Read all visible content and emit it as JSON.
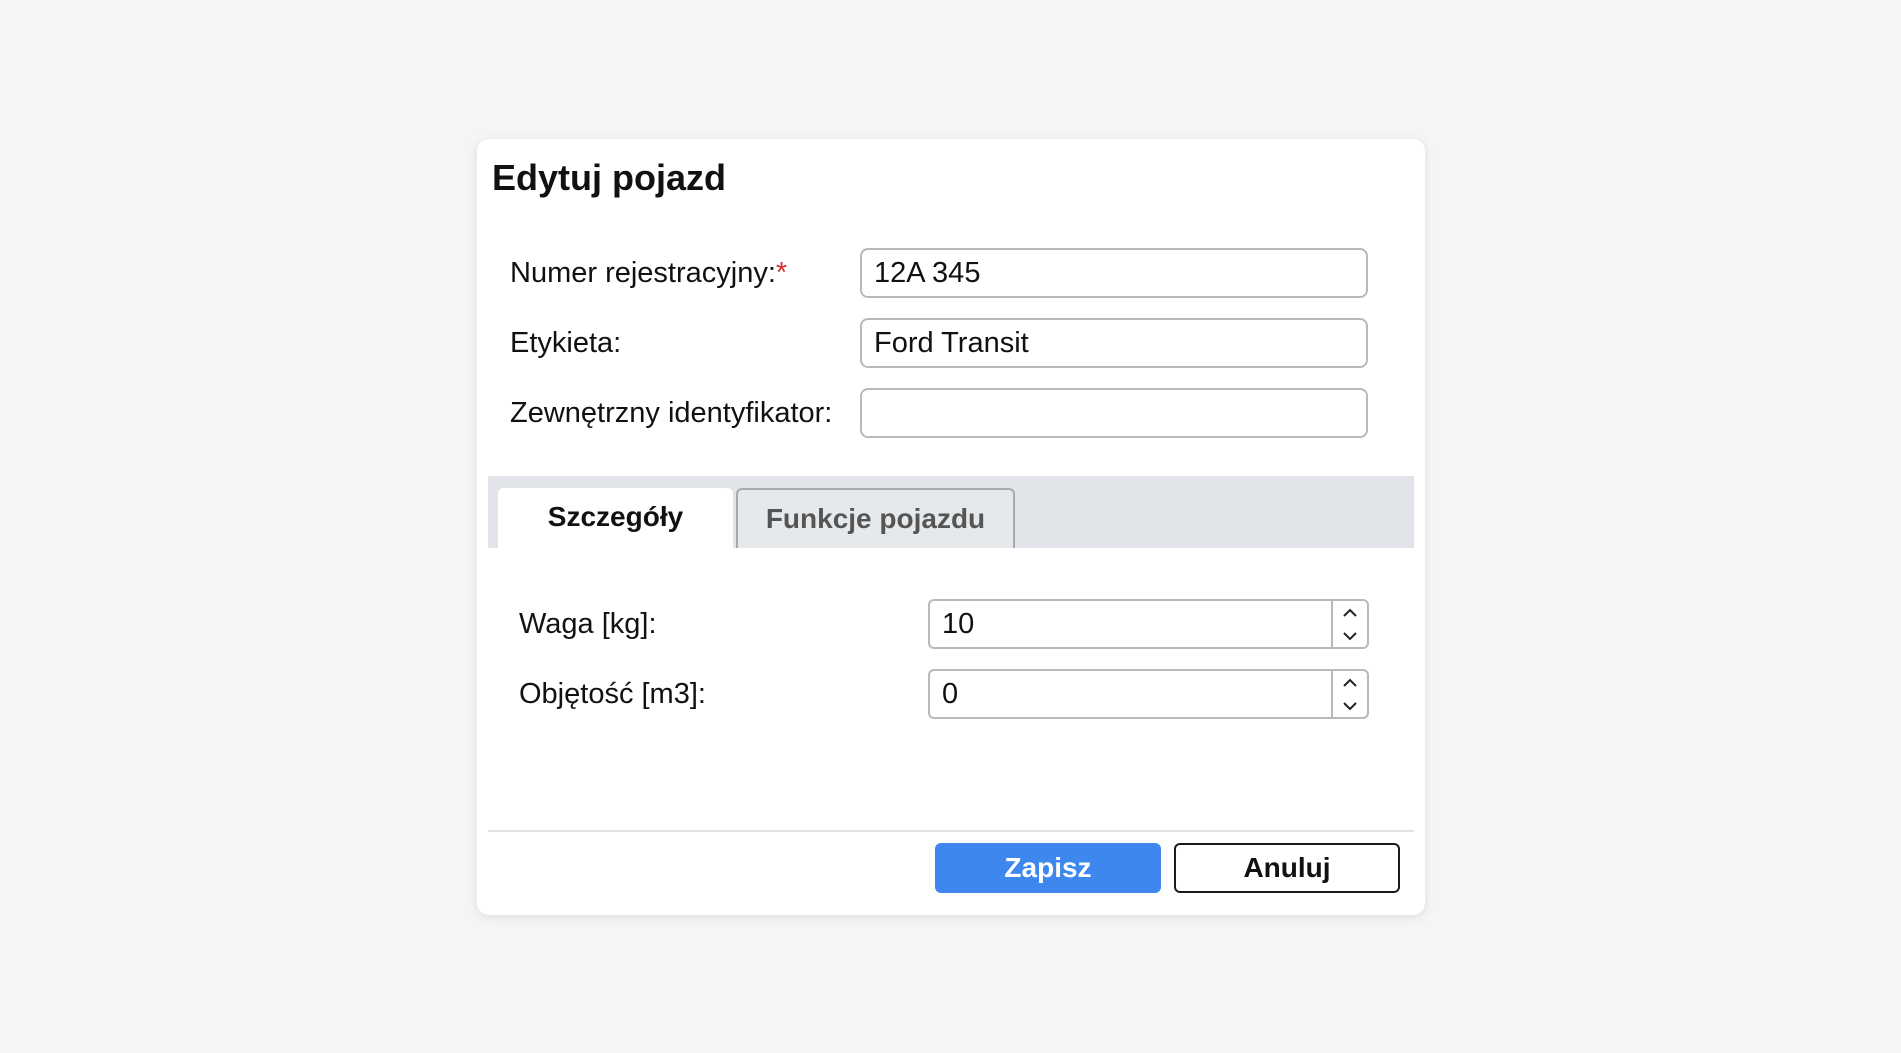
{
  "dialog": {
    "title": "Edytuj pojazd"
  },
  "form": {
    "registration": {
      "label": "Numer rejestracyjny:",
      "required_mark": "*",
      "value": "12A 345"
    },
    "label_field": {
      "label": "Etykieta:",
      "value": "Ford Transit"
    },
    "external_id": {
      "label": "Zewnętrzny identyfikator:",
      "value": ""
    }
  },
  "tabs": [
    {
      "label": "Szczegóły",
      "active": true
    },
    {
      "label": "Funkcje pojazdu",
      "active": false
    }
  ],
  "details": {
    "weight": {
      "label": "Waga [kg]:",
      "value": "10"
    },
    "volume": {
      "label": "Objętość [m3]:",
      "value": "0"
    }
  },
  "buttons": {
    "save_label": "Zapisz",
    "cancel_label": "Anuluj"
  },
  "colors": {
    "primary": "#3d87ee",
    "required": "#d32f2f",
    "tab_strip": "#e1e5e9"
  },
  "icons": {
    "spinner_up": "chevron-up-icon",
    "spinner_down": "chevron-down-icon"
  }
}
